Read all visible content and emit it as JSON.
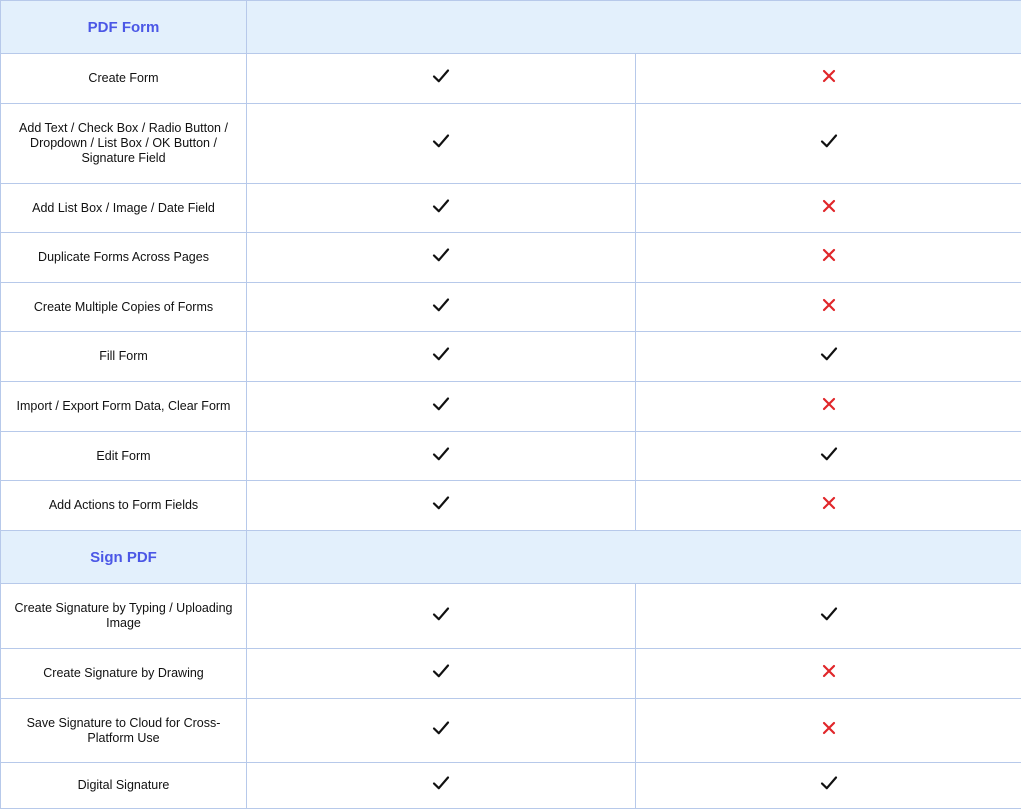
{
  "colors": {
    "section_bg": "#e3f0fc",
    "section_title": "#4b57e6",
    "border": "#b7c9ea",
    "check": "#111111",
    "cross": "#e0262a"
  },
  "sections": [
    {
      "title": "PDF Form",
      "rows": [
        {
          "feature": "Create Form",
          "col1": "check-icon",
          "col2": "cross-icon"
        },
        {
          "feature": "Add Text / Check Box / Radio Button / Dropdown / List Box / OK Button / Signature Field",
          "col1": "check-icon",
          "col2": "check-icon"
        },
        {
          "feature": "Add List Box / Image / Date Field",
          "col1": "check-icon",
          "col2": "cross-icon"
        },
        {
          "feature": "Duplicate Forms Across Pages",
          "col1": "check-icon",
          "col2": "cross-icon"
        },
        {
          "feature": "Create Multiple Copies of Forms",
          "col1": "check-icon",
          "col2": "cross-icon"
        },
        {
          "feature": "Fill Form",
          "col1": "check-icon",
          "col2": "check-icon"
        },
        {
          "feature": "Import / Export Form Data, Clear Form",
          "col1": "check-icon",
          "col2": "cross-icon"
        },
        {
          "feature": "Edit Form",
          "col1": "check-icon",
          "col2": "check-icon"
        },
        {
          "feature": "Add Actions to Form Fields",
          "col1": "check-icon",
          "col2": "cross-icon"
        }
      ]
    },
    {
      "title": "Sign PDF",
      "rows": [
        {
          "feature": "Create Signature by Typing / Uploading Image",
          "col1": "check-icon",
          "col2": "check-icon"
        },
        {
          "feature": "Create Signature by Drawing",
          "col1": "check-icon",
          "col2": "cross-icon"
        },
        {
          "feature": "Save Signature to Cloud for Cross-Platform Use",
          "col1": "check-icon",
          "col2": "cross-icon"
        },
        {
          "feature": "Digital Signature",
          "col1": "check-icon",
          "col2": "check-icon"
        }
      ]
    }
  ]
}
